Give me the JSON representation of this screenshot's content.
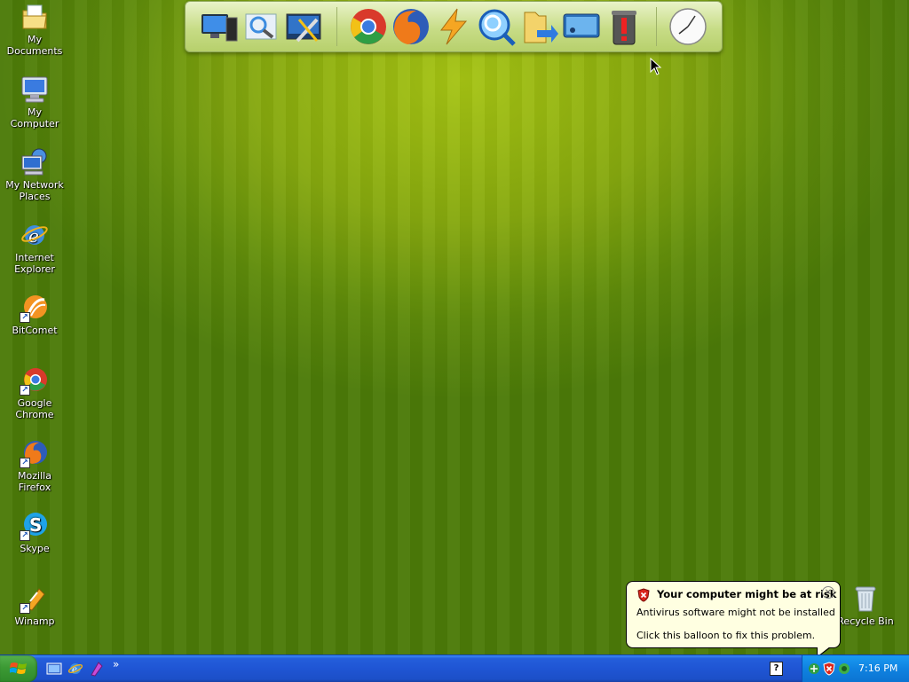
{
  "desktop": {
    "icons": [
      {
        "label": "My Documents",
        "icon": "my-documents-icon"
      },
      {
        "label": "My Computer",
        "icon": "my-computer-icon"
      },
      {
        "label": "My Network Places",
        "icon": "network-places-icon"
      },
      {
        "label": "Internet Explorer",
        "icon": "internet-explorer-icon"
      },
      {
        "label": "BitComet",
        "icon": "bitcomet-icon"
      },
      {
        "label": "Google Chrome",
        "icon": "google-chrome-icon"
      },
      {
        "label": "Mozilla Firefox",
        "icon": "firefox-icon"
      },
      {
        "label": "Skype",
        "icon": "skype-icon"
      },
      {
        "label": "Winamp",
        "icon": "winamp-icon"
      }
    ],
    "recycle_bin": {
      "label": "Recycle Bin",
      "icon": "recycle-bin-icon"
    }
  },
  "dock": {
    "items": [
      "computer-icon",
      "search-photo-icon",
      "settings-tools-icon",
      "google-chrome-icon",
      "firefox-icon",
      "winamp-lightning-icon",
      "magnifier-search-icon",
      "folder-arrow-icon",
      "display-icon",
      "trash-icon",
      "clock-icon"
    ]
  },
  "balloon": {
    "title": "Your computer might be at risk",
    "line1": "Antivirus software might not be installed",
    "line2": "Click this balloon to fix this problem.",
    "close_icon": "close-icon"
  },
  "taskbar": {
    "clock": "7:16 PM",
    "quick_launch": [
      "show-desktop-icon",
      "internet-explorer-icon",
      "winamp-icon"
    ],
    "overflow": "»",
    "help_glyph": "?"
  },
  "colors": {
    "desktop_green": "#86a80e",
    "taskbar_blue": "#245edb",
    "start_green": "#3c9a34",
    "balloon_bg": "#ffffe1"
  }
}
